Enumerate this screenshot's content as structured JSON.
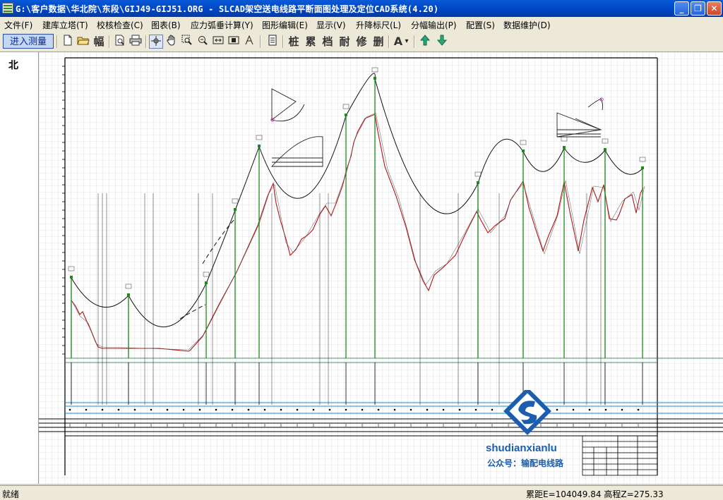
{
  "window": {
    "title": "G:\\客户数据\\华北院\\东段\\GIJ49-GIJ51.ORG - SLCAD架空送电线路平断面图处理及定位CAD系统(4.20)",
    "minimize": "_",
    "maximize": "❐",
    "close": "✕"
  },
  "menu": [
    "文件(F)",
    "建库立塔(T)",
    "校核检查(C)",
    "图表(B)",
    "应力弧垂计算(Y)",
    "图形编辑(E)",
    "显示(V)",
    "升降标尺(L)",
    "分幅输出(P)",
    "配置(S)",
    "数据维护(D)"
  ],
  "toolbar": {
    "main_button": "进入测量",
    "cjk_buttons": [
      "桩",
      "累",
      "档",
      "耐",
      "修",
      "删"
    ],
    "text_tool": "A",
    "dropdown": "▾",
    "icons": [
      "new-icon",
      "open-icon",
      "frame-icon",
      "print-preview-icon",
      "print-icon",
      "crosshair-icon",
      "pan-hand-icon",
      "zoom-window-icon",
      "zoom-out-icon",
      "zoom-extents-icon",
      "zoom-all-icon",
      "measure-icon",
      "notes-icon",
      "arrow-up-icon",
      "arrow-down-icon"
    ]
  },
  "drawing": {
    "north_label": "北"
  },
  "watermark": {
    "site": "shudianxianlu",
    "account": "公众号：输配电线路"
  },
  "status": {
    "left": "就绪",
    "right": "累距E=104049.84 高程Z=275.33"
  }
}
